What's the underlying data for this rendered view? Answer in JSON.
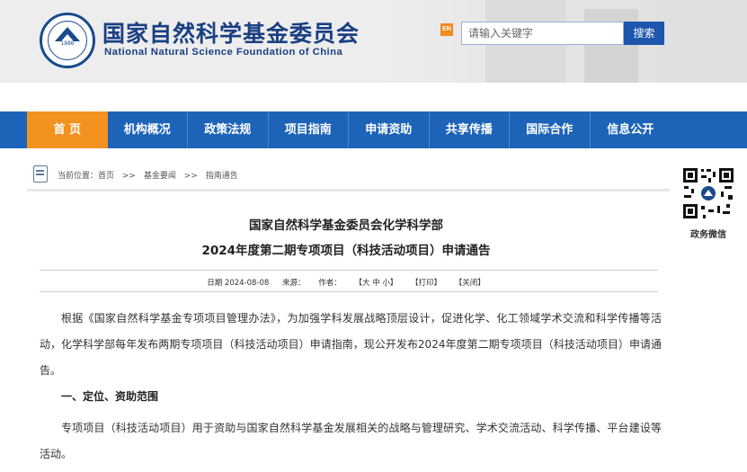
{
  "header": {
    "logo_year": "1986",
    "org_name_cn": "国家自然科学基金委员会",
    "org_name_en": "National Natural Science Foundation of China",
    "en_badge": "EN",
    "search_placeholder": "请输入关键字",
    "search_button": "搜索"
  },
  "nav": {
    "items": [
      "首 页",
      "机构概况",
      "政策法规",
      "项目指南",
      "申请资助",
      "共享传播",
      "国际合作",
      "信息公开"
    ]
  },
  "breadcrumb": {
    "prefix": "当前位置：首页",
    "sep1": ">>",
    "level1": "基金要闻",
    "sep2": ">>",
    "level2": "指南通告"
  },
  "article": {
    "title_line1": "国家自然科学基金委员会化学科学部",
    "title_line2": "2024年度第二期专项项目（科技活动项目）申请通告",
    "meta_date": "日期 2024-08-08",
    "meta_source": "来源：",
    "meta_author": "作者：",
    "meta_font": "【大 中 小】",
    "meta_print": "【打印】",
    "meta_close": "【关闭】",
    "para1": "根据《国家自然科学基金专项项目管理办法》，为加强学科发展战略顶层设计，促进化学、化工领域学术交流和科学传播等活动，化学科学部每年发布两期专项项目（科技活动项目）申请指南，现公开发布2024年度第二期专项项目（科技活动项目）申请通告。",
    "heading1": "一、定位、资助范围",
    "para2": "专项项目（科技活动项目）用于资助与国家自然科学基金发展相关的战略与管理研究、学术交流活动、科学传播、平台建设等活动。"
  },
  "sidebar": {
    "qr_label": "政务微信"
  },
  "colors": {
    "brand_blue": "#1a3f82",
    "nav_blue": "#1d64b8",
    "nav_active": "#f4921f",
    "search_button": "#1d56ad"
  }
}
